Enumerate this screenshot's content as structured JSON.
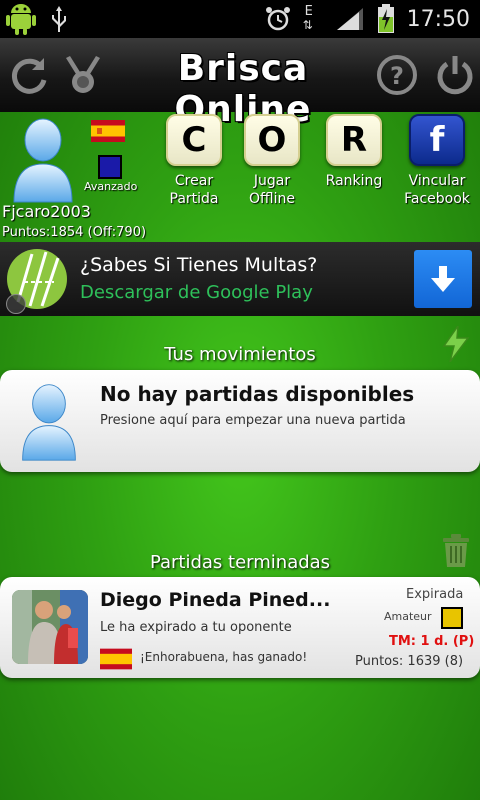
{
  "status_bar": {
    "time": "17:50",
    "network": "E"
  },
  "header": {
    "title": "Brisca Online"
  },
  "profile": {
    "level": "Avanzado",
    "username": "Fjcaro2003",
    "points": "Puntos:1854 (Off:790)"
  },
  "actions": [
    {
      "letter": "C",
      "label": "Crear\nPartida"
    },
    {
      "letter": "O",
      "label": "Jugar\nOffline"
    },
    {
      "letter": "R",
      "label": "Ranking"
    },
    {
      "letter": "f",
      "label": "Vincular\nFacebook"
    }
  ],
  "ad": {
    "title": "¿Sabes Si Tienes Multas?",
    "subtitle": "Descargar de Google Play"
  },
  "moves": {
    "section_title": "Tus movimientos",
    "empty_title": "No hay partidas disponibles",
    "empty_sub": "Presione aquí para empezar una nueva partida"
  },
  "finished": {
    "section_title": "Partidas terminadas",
    "game": {
      "opponent": "Diego Pineda  Pined...",
      "message": "Le ha expirado a tu oponente",
      "result": "¡Enhorabuena, has ganado!",
      "status": "Expirada",
      "level": "Amateur",
      "time": "TM: 1 d. (P)",
      "points": "Puntos: 1639 (8)"
    }
  },
  "colors": {
    "background_green": "#2fa012",
    "ad_link_green": "#2ec05a",
    "time_red": "#e01010",
    "level_avanzado": "#1a1aa8",
    "level_amateur": "#e8c400"
  }
}
